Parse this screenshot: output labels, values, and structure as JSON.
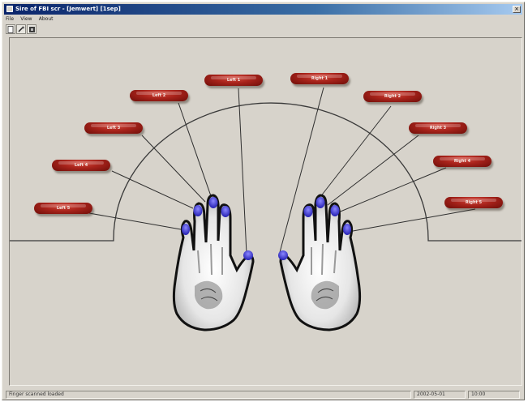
{
  "window": {
    "title": "Sire of FBI scr - [Jemwert] [1sep]"
  },
  "menu": {
    "items": [
      "File",
      "View",
      "About"
    ]
  },
  "toolbar": {
    "buttons": [
      {
        "name": "new-icon"
      },
      {
        "name": "scan-icon"
      },
      {
        "name": "capture-icon"
      }
    ]
  },
  "fingers": {
    "left_hand": [
      {
        "label": "Left 5"
      },
      {
        "label": "Left 4"
      },
      {
        "label": "Left 3"
      },
      {
        "label": "Left 2"
      },
      {
        "label": "Left 1"
      }
    ],
    "right_hand": [
      {
        "label": "Right 1"
      },
      {
        "label": "Right 2"
      },
      {
        "label": "Right 3"
      },
      {
        "label": "Right 4"
      },
      {
        "label": "Right 5"
      }
    ],
    "fingertip_color": "#3b37c8",
    "button_color": "#a8231b"
  },
  "status": {
    "message": "Finger scanned loaded",
    "date": "2002-05-01",
    "time": "10:00"
  }
}
